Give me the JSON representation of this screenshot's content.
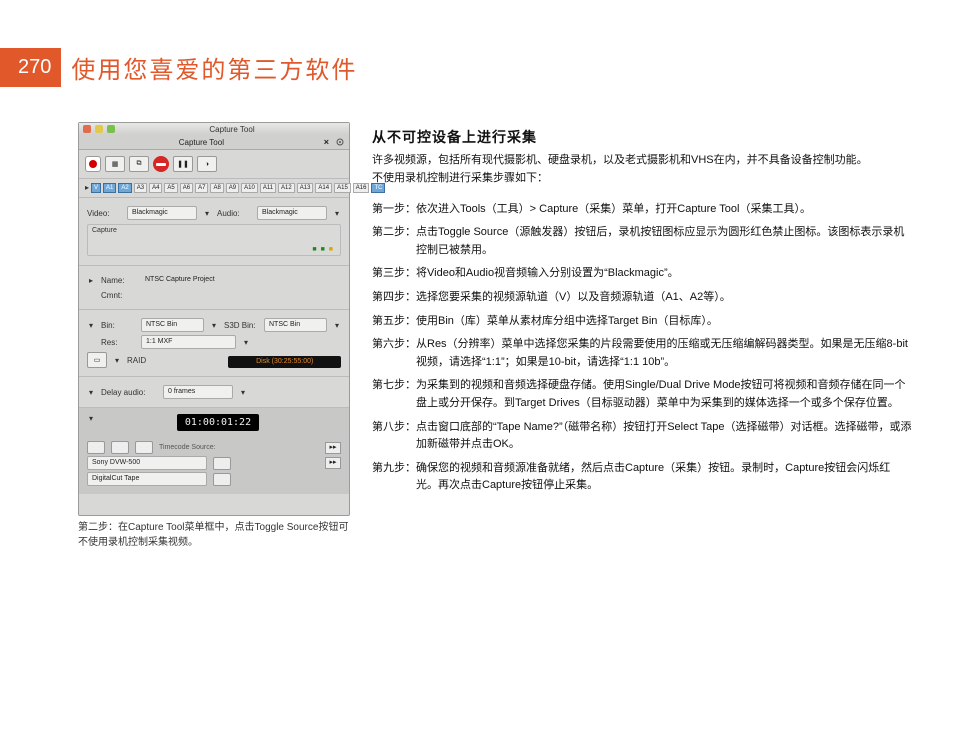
{
  "page_number": "270",
  "page_title": "使用您喜爱的第三方软件",
  "screenshot": {
    "window_title": "Capture Tool",
    "tool_header": "Capture Tool",
    "tracks": [
      "V",
      "A1",
      "A2",
      "A3",
      "A4",
      "A5",
      "A6",
      "A7",
      "A8",
      "A9",
      "A10",
      "A11",
      "A12",
      "A13",
      "A14",
      "A15",
      "A16",
      "TC"
    ],
    "video_label": "Video:",
    "video_value": "Blackmagic",
    "audio_label": "Audio:",
    "audio_value": "Blackmagic",
    "capture_label": "Capture",
    "name_label": "Name:",
    "name_value": "NTSC Capture Project",
    "cmnt_label": "Cmnt:",
    "bin_label": "Bin:",
    "bin_value": "NTSC Bin",
    "s3d_label": "S3D Bin:",
    "s3d_value": "NTSC Bin",
    "res_label": "Res:",
    "res_value": "1:1 MXF",
    "raid_label": "RAID",
    "disk_text": "Disk (30:25:55:00)",
    "delay_label": "Delay audio:",
    "delay_value": "0 frames",
    "timecode": "01:00:01:22",
    "tc_src_label": "Timecode Source:",
    "tc_src_value": "Sony DVW-500",
    "tape_value": "DigitalCut Tape"
  },
  "caption": "第二步：在Capture Tool菜单框中，点击Toggle Source按钮可不使用录机控制采集视频。",
  "article": {
    "heading": "从不可控设备上进行采集",
    "intro1": "许多视频源，包括所有现代摄影机、硬盘录机，以及老式摄影机和VHS在内，并不具备设备控制功能。",
    "intro2": "不使用录机控制进行采集步骤如下：",
    "steps": [
      {
        "k": "第一步：",
        "t": "依次进入Tools（工具）> Capture（采集）菜单，打开Capture Tool（采集工具）。"
      },
      {
        "k": "第二步：",
        "t": "点击Toggle Source（源触发器）按钮后，录机按钮图标应显示为圆形红色禁止图标。该图标表示录机控制已被禁用。"
      },
      {
        "k": "第三步：",
        "t": "将Video和Audio视音频输入分别设置为“Blackmagic”。"
      },
      {
        "k": "第四步：",
        "t": "选择您要采集的视频源轨道（V）以及音频源轨道（A1、A2等）。"
      },
      {
        "k": "第五步：",
        "t": "使用Bin（库）菜单从素材库分组中选择Target Bin（目标库）。"
      },
      {
        "k": "第六步：",
        "t": "从Res（分辨率）菜单中选择您采集的片段需要使用的压缩或无压缩编解码器类型。如果是无压缩8-bit视频，请选择“1:1”；如果是10-bit，请选择“1:1 10b”。"
      },
      {
        "k": "第七步：",
        "t": "为采集到的视频和音频选择硬盘存储。使用Single/Dual Drive Mode按钮可将视频和音频存储在同一个盘上或分开保存。到Target Drives（目标驱动器）菜单中为采集到的媒体选择一个或多个保存位置。"
      },
      {
        "k": "第八步：",
        "t": "点击窗口底部的“Tape Name?”（磁带名称）按钮打开Select Tape（选择磁带）对话框。选择磁带，或添加新磁带并点击OK。"
      },
      {
        "k": "第九步：",
        "t": "确保您的视频和音频源准备就绪，然后点击Capture（采集）按钮。录制时，Capture按钮会闪烁红光。再次点击Capture按钮停止采集。"
      }
    ]
  }
}
